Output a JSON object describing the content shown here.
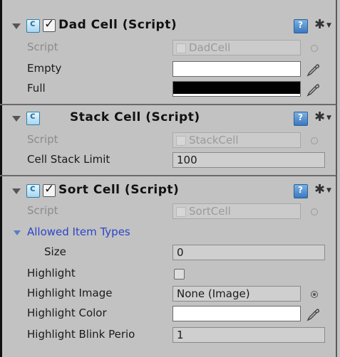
{
  "components": [
    {
      "title": "Dad Cell (Script)",
      "enabled": true,
      "script_label": "Script",
      "script_value": "DadCell",
      "props": [
        {
          "label": "Empty",
          "type": "color",
          "color": "#ffffff"
        },
        {
          "label": "Full",
          "type": "color",
          "color": "#000000"
        }
      ]
    },
    {
      "title": "Stack Cell (Script)",
      "enabled": null,
      "script_label": "Script",
      "script_value": "StackCell",
      "props": [
        {
          "label": "Cell Stack Limit",
          "type": "number",
          "value": "100"
        }
      ]
    },
    {
      "title": "Sort Cell (Script)",
      "enabled": true,
      "script_label": "Script",
      "script_value": "SortCell",
      "foldout": {
        "label": "Allowed Item Types",
        "expanded": true,
        "size_label": "Size",
        "size_value": "0"
      },
      "props": [
        {
          "label": "Highlight",
          "type": "bool",
          "checked": false
        },
        {
          "label": "Highlight Image",
          "type": "object",
          "value": "None (Image)"
        },
        {
          "label": "Highlight Color",
          "type": "color",
          "color": "#ffffff"
        },
        {
          "label": "Highlight Blink Perio",
          "type": "number",
          "value": "1"
        }
      ]
    }
  ],
  "icons": {
    "fold": "triangle-down",
    "script": "csharp-script",
    "help": "help-book",
    "settings": "gear",
    "picker": "eyedropper",
    "object_picker": "target-circle"
  },
  "colors": {
    "panel_bg": "#c2c2c2",
    "foldout_text": "#2b45c8",
    "muted_text": "#8b8b8b"
  }
}
